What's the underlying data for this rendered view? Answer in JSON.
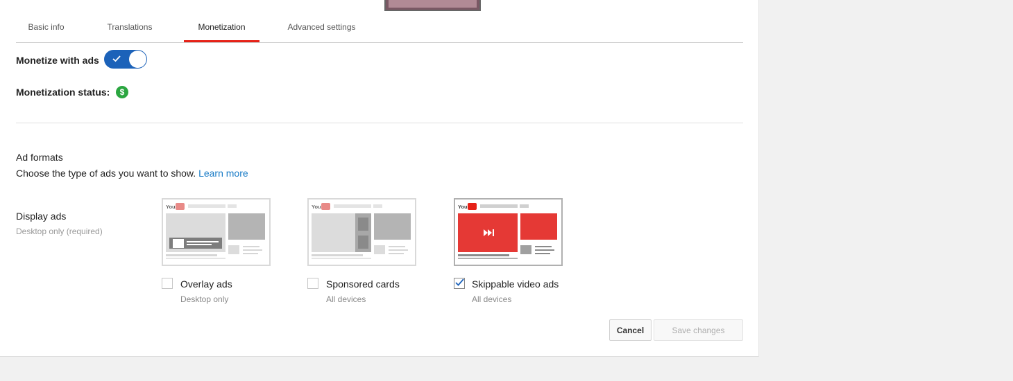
{
  "tabs": [
    {
      "label": "Basic info",
      "active": false
    },
    {
      "label": "Translations",
      "active": false
    },
    {
      "label": "Monetization",
      "active": true
    },
    {
      "label": "Advanced settings",
      "active": false
    }
  ],
  "monetization": {
    "toggle_label": "Monetize with ads",
    "toggle_on": true,
    "status_label": "Monetization status:",
    "status_icon": "dollar-circle-icon",
    "status_color": "#2ba640"
  },
  "ad_formats": {
    "heading": "Ad formats",
    "description": "Choose the type of ads you want to show.",
    "learn_more": "Learn more",
    "display_ads": {
      "label": "Display ads",
      "note": "Desktop only (required)"
    },
    "options": [
      {
        "label": "Overlay ads",
        "sub": "Desktop only",
        "checked": false
      },
      {
        "label": "Sponsored cards",
        "sub": "All devices",
        "checked": false
      },
      {
        "label": "Skippable video ads",
        "sub": "All devices",
        "checked": true
      }
    ]
  },
  "buttons": {
    "cancel": "Cancel",
    "save": "Save changes"
  },
  "colors": {
    "accent": "#1c62b9",
    "tab_indicator": "#e62117",
    "ad_red": "#e62117",
    "link": "#167ac6"
  }
}
